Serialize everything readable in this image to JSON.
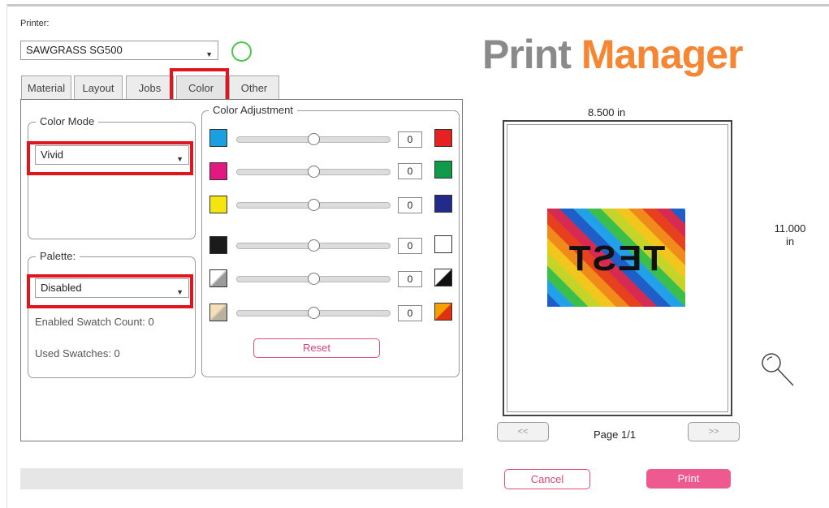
{
  "printer": {
    "label": "Printer:",
    "selected": "SAWGRASS SG500"
  },
  "logo": {
    "word1": "Print",
    "word2": "Manager"
  },
  "tabs": [
    {
      "label": "Material"
    },
    {
      "label": "Layout"
    },
    {
      "label": "Jobs"
    },
    {
      "label": "Color"
    },
    {
      "label": "Other"
    }
  ],
  "active_tab": "Color",
  "color_mode": {
    "title": "Color Mode",
    "selected": "Vivid"
  },
  "palette": {
    "title": "Palette:",
    "selected": "Disabled",
    "enabled_swatch_count": "Enabled Swatch Count: 0",
    "used_swatches": "Used Swatches: 0"
  },
  "color_adjustment": {
    "title": "Color Adjustment",
    "rows": [
      {
        "left": "cyan",
        "right": "red",
        "value": "0",
        "level": 0.5
      },
      {
        "left": "magenta",
        "right": "green",
        "value": "0",
        "level": 0.5
      },
      {
        "left": "yellow",
        "right": "blue",
        "value": "0",
        "level": 0.5
      },
      {
        "left": "black",
        "right": "white",
        "value": "0",
        "level": 0.5
      },
      {
        "left": "contrast-low",
        "right": "contrast-high",
        "value": "0",
        "level": 0.5
      },
      {
        "left": "saturation-low",
        "right": "saturation-high",
        "value": "0",
        "level": 0.5
      }
    ],
    "reset_label": "Reset"
  },
  "colors": {
    "cyan": "#1aa0e0",
    "red": "#e52222",
    "magenta": "#e0187f",
    "green": "#11994a",
    "yellow": "#f5e50f",
    "blue": "#222b8c",
    "black": "#1b1b1b",
    "white": "#ffffff",
    "accent_red": "#e0161f",
    "accent_pink": "#ee5a8f",
    "logo_orange": "#f58634"
  },
  "preview": {
    "width_label": "8.500 in",
    "height_label_value": "11.000",
    "height_label_unit": "in",
    "image_text": "TEST",
    "page_label": "Page 1/1",
    "prev_label": "<<",
    "next_label": ">>"
  },
  "actions": {
    "cancel": "Cancel",
    "print": "Print"
  },
  "icons": {
    "zoom": "magnifier-icon"
  }
}
